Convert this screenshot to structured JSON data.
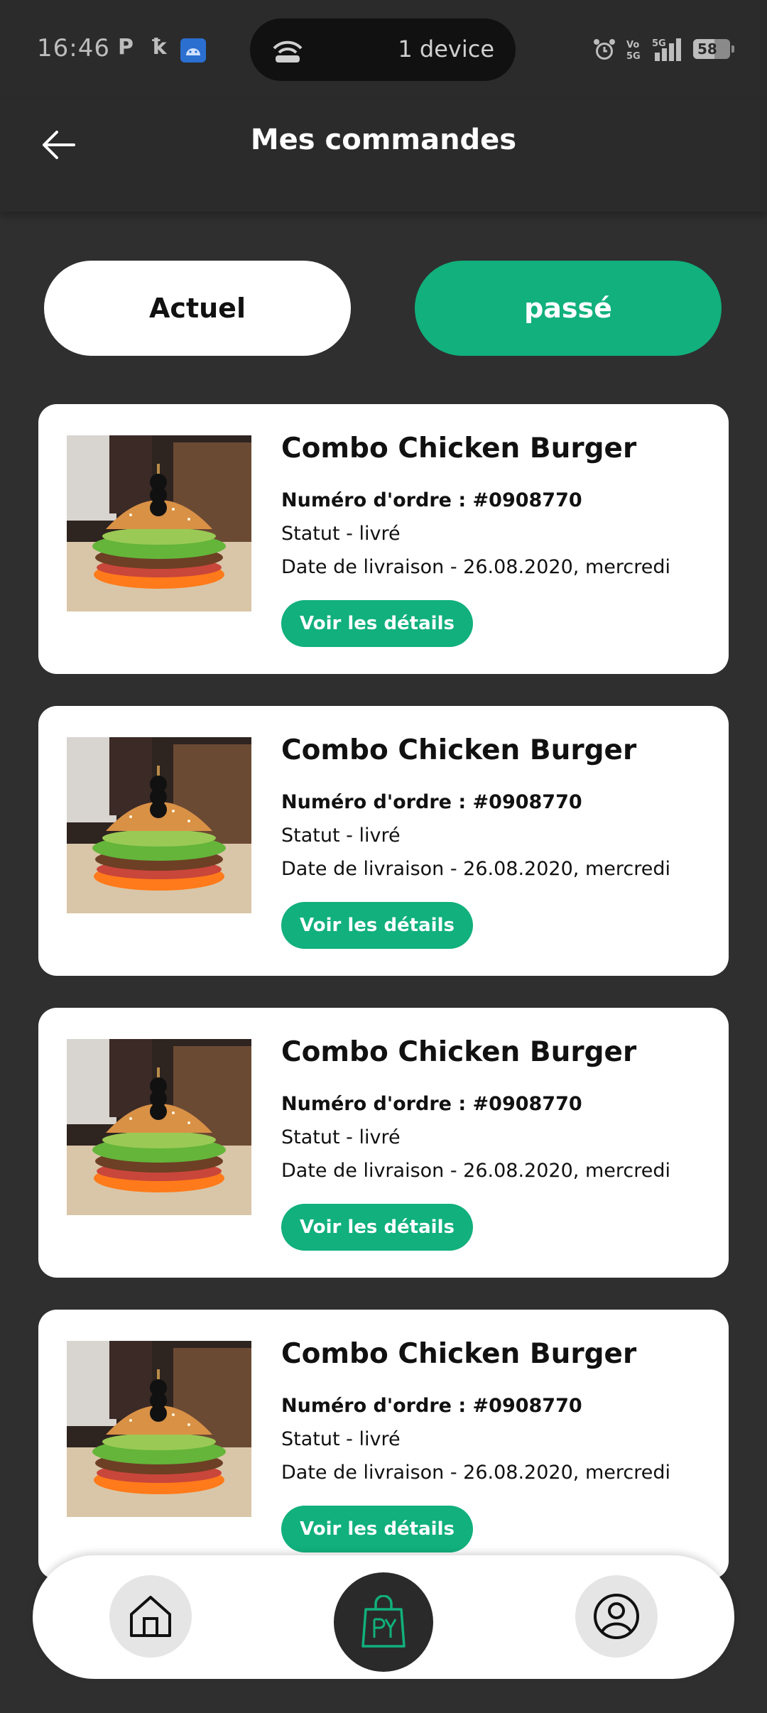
{
  "status_bar": {
    "time": "16:46",
    "pill_text": "1 device",
    "battery": "58",
    "left_icons": [
      "p-icon",
      "k-icon",
      "android-icon"
    ],
    "right_icons": [
      "alarm-icon",
      "volte-icon",
      "signal-5g-icon",
      "battery-icon"
    ]
  },
  "header": {
    "title": "Mes commandes"
  },
  "tabs": [
    {
      "label": "Actuel"
    },
    {
      "label": "passé"
    }
  ],
  "orders": [
    {
      "title": "Combo Chicken Burger",
      "order_number": "Numéro d'ordre : #0908770",
      "status": "Statut - livré",
      "delivery_date": "Date de livraison -  26.08.2020, mercredi",
      "button_label": "Voir les détails"
    },
    {
      "title": "Combo Chicken Burger",
      "order_number": "Numéro d'ordre : #0908770",
      "status": "Statut - livré",
      "delivery_date": "Date de livraison -  26.08.2020, mercredi",
      "button_label": "Voir les détails"
    },
    {
      "title": "Combo Chicken Burger",
      "order_number": "Numéro d'ordre : #0908770",
      "status": "Statut - livré",
      "delivery_date": "Date de livraison -  26.08.2020, mercredi",
      "button_label": "Voir les détails"
    },
    {
      "title": "Combo Chicken Burger",
      "order_number": "Numéro d'ordre : #0908770",
      "status": "Statut - livré",
      "delivery_date": "Date de livraison -  26.08.2020, mercredi",
      "button_label": "Voir les détails"
    }
  ],
  "bottom_nav": {
    "icons": [
      "home-icon",
      "orders-bag-icon",
      "profile-icon"
    ]
  },
  "colors": {
    "accent": "#11b07c",
    "background": "#2f2f2f",
    "card": "#ffffff"
  }
}
